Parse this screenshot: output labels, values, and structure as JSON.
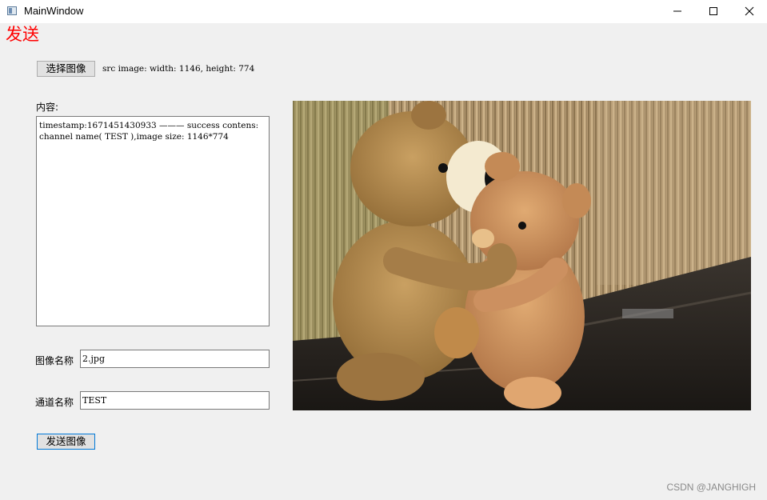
{
  "window": {
    "title": "MainWindow",
    "controls": [
      "minimize-icon",
      "maximize-icon",
      "close-icon"
    ]
  },
  "header": {
    "send_title": "发送",
    "send_title_color": "#ff0000"
  },
  "toolbar": {
    "select_image_label": "选择图像",
    "src_info": "src image: width: 1146, height: 774"
  },
  "content": {
    "label": "内容:",
    "text": "timestamp:1671451430933 ——— success contens:\nchannel name( TEST ),image size: 1146*774"
  },
  "form": {
    "image_name_label": "图像名称",
    "image_name_value": "2.jpg",
    "channel_name_label": "通道名称",
    "channel_name_value": "TEST"
  },
  "actions": {
    "send_image_label": "发送图像"
  },
  "preview": {
    "description_icon": "teddy-bears-photo"
  },
  "watermark": "CSDN @JANGHIGH"
}
